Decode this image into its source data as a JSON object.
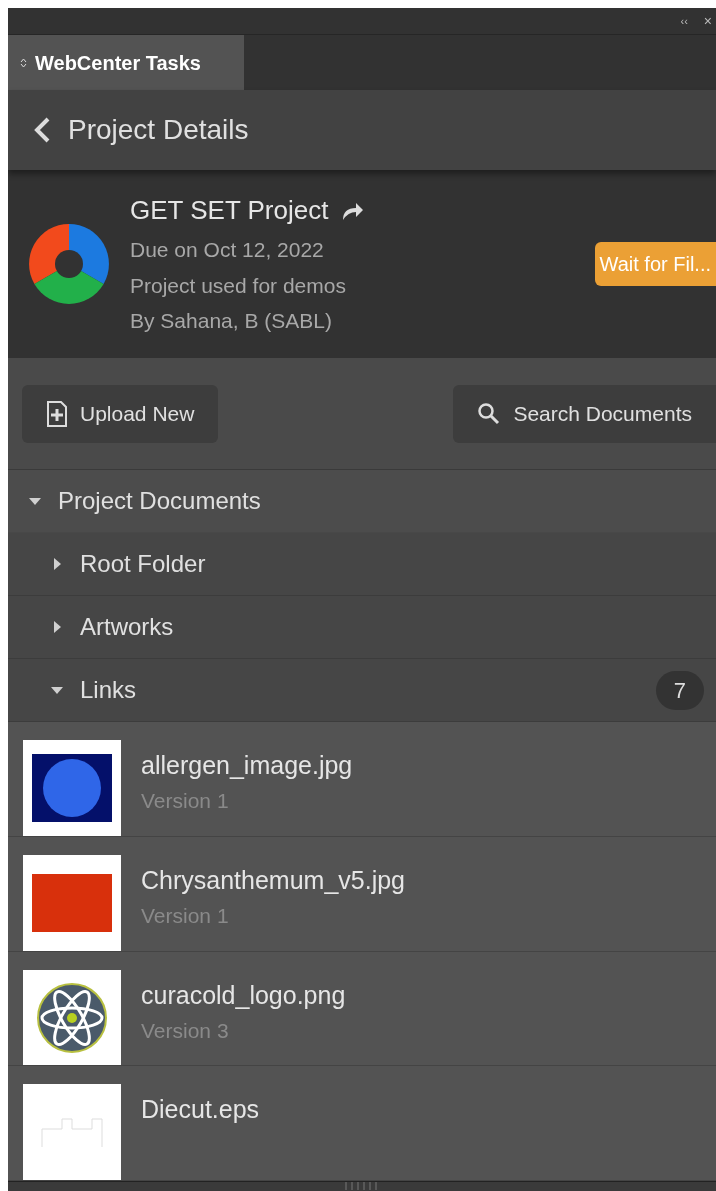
{
  "panel_controls": {
    "collapse": "‹‹",
    "close": "×"
  },
  "tabs": [
    {
      "label": "WebCenter Tasks",
      "selected": true
    }
  ],
  "header": {
    "title": "Project Details"
  },
  "project": {
    "name": "GET SET Project",
    "due": "Due on Oct 12, 2022",
    "description": "Project used for demos",
    "owner": "By Sahana, B (SABL)",
    "status": "Wait for Fil..."
  },
  "buttons": [
    {
      "label": "Upload New",
      "kind": "upload"
    },
    {
      "label": "Search Documents",
      "kind": "search"
    }
  ],
  "tree": [
    {
      "label": "Project Documents",
      "expanded": true,
      "children": [
        {
          "label": "Root Folder",
          "expanded": false
        },
        {
          "label": "Artworks",
          "expanded": false
        },
        {
          "label": "Links",
          "expanded": true,
          "count": "7",
          "children": [
            {
              "name": "allergen_image.jpg",
              "version": "Version 1",
              "kind": "globe"
            },
            {
              "name": "Chrysanthemum_v5.jpg",
              "version": "Version 1",
              "kind": "flower"
            },
            {
              "name": "curacold_logo.png",
              "version": "Version 3",
              "kind": "atom"
            },
            {
              "name": "Diecut.eps",
              "kind": "diecut"
            }
          ]
        }
      ]
    }
  ]
}
